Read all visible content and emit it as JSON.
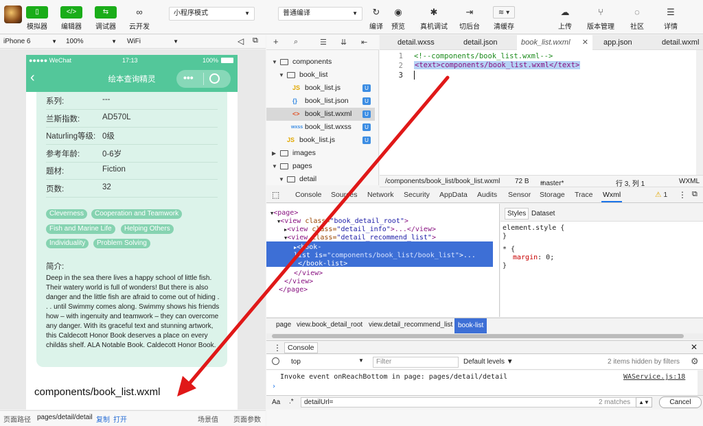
{
  "toolbar": {
    "simulator": "模拟器",
    "editor": "编辑器",
    "debugger": "调试器",
    "cloud": "云开发",
    "mode_select": "小程序模式",
    "compile_select": "普通编译",
    "compile": "编译",
    "preview": "预览",
    "real_debug": "真机调试",
    "background": "切后台",
    "clear_cache": "清缓存",
    "upload": "上传",
    "version": "版本管理",
    "community": "社区",
    "details": "详情",
    "accent_color": "#1aad19"
  },
  "simulator": {
    "device": "iPhone 6",
    "zoom": "100%",
    "network": "WiFi",
    "status_carrier": "●●●●● WeChat",
    "status_time": "17:13",
    "status_battery": "100%",
    "nav_title": "绘本查询精灵",
    "theme_color": "#53c79a",
    "info_rows": [
      {
        "key": "系列:",
        "value": "---"
      },
      {
        "key": "兰斯指数:",
        "value": "AD570L"
      },
      {
        "key": "Naturling等级:",
        "value": "0级"
      },
      {
        "key": "参考年龄:",
        "value": "0-6岁"
      },
      {
        "key": "题材:",
        "value": "Fiction"
      },
      {
        "key": "页数:",
        "value": "32"
      }
    ],
    "tags": [
      "Cleverness",
      "Cooperation and Teamwork",
      "Fish and Marine Life",
      "Helping Others",
      "Individuality",
      "Problem Solving"
    ],
    "summary_label": "简介:",
    "summary": "Deep in the sea there lives a happy school of little fish. Their watery world is full of wonders! But there is also danger and the little fish are afraid to come out of hiding . . . until Swimmy comes along. Swimmy shows his friends how – with ingenuity and teamwork – they can overcome any danger. With its graceful text and stunning artwork, this Caldecott Honor Book deserves a place on every childäs shelf. ALA Notable Book. Caldecott Honor Book.",
    "component_text": "components/book_list.wxml"
  },
  "footer": {
    "path_label": "页面路径",
    "path": "pages/detail/detail",
    "copy": "复制",
    "open": "打开",
    "scene": "场景值",
    "params": "页面参数"
  },
  "tree": {
    "items": [
      {
        "name": "components",
        "type": "folder"
      },
      {
        "name": "book_list",
        "type": "folder"
      },
      {
        "name": "book_list.js",
        "type": "js",
        "badge": "U"
      },
      {
        "name": "book_list.json",
        "type": "json",
        "badge": "U"
      },
      {
        "name": "book_list.wxml",
        "type": "wxml",
        "badge": "U"
      },
      {
        "name": "book_list.wxss",
        "type": "wxss",
        "badge": "U"
      },
      {
        "name": "book_list.js",
        "type": "js",
        "badge": "U"
      },
      {
        "name": "images",
        "type": "folder"
      },
      {
        "name": "pages",
        "type": "folder"
      },
      {
        "name": "detail",
        "type": "folder"
      }
    ]
  },
  "editor": {
    "tabs": [
      "detail.wxss",
      "detail.json",
      "book_list.wxml",
      "app.json",
      "detail.wxml"
    ],
    "lines": [
      "<!--components/book_list.wxml-->",
      "<text>components/book_list.wxml</text>",
      ""
    ],
    "line_numbers": [
      "1",
      "2",
      "3"
    ],
    "status_path": "/components/book_list/book_list.wxml",
    "status_size": "72 B",
    "status_branch": "master*",
    "status_pos": "行 3, 列 1",
    "status_lang": "WXML"
  },
  "devtools": {
    "tabs": [
      "Console",
      "Sources",
      "Network",
      "Security",
      "AppData",
      "Audits",
      "Sensor",
      "Storage",
      "Trace",
      "Wxml"
    ],
    "warning_count": "1",
    "wxml_lines": [
      {
        "tag_open": "<page>",
        "attr": "",
        "val": "",
        "tail": ""
      },
      {
        "tag_open": "<view",
        "attr": " class=",
        "val": "\"book_detail_root\"",
        "tail": ">"
      },
      {
        "tag_open": "<view",
        "attr": " class=",
        "val": "\"detail_info\"",
        "tail": ">...</view>"
      },
      {
        "tag_open": "<view",
        "attr": " class=",
        "val": "\"detail_recommend_list\"",
        "tail": ">"
      },
      {
        "tag_open": "<book-",
        "attr": "",
        "val": "",
        "tail": ""
      },
      {
        "tag_open": "list",
        "attr": " is=",
        "val": "\"components/book_list/book_list\"",
        "tail": ">..."
      },
      {
        "tag_open": "</book-list>",
        "attr": "",
        "val": "",
        "tail": ""
      },
      {
        "tag_open": "</view>",
        "attr": "",
        "val": "",
        "tail": ""
      },
      {
        "tag_open": "</view>",
        "attr": "",
        "val": "",
        "tail": ""
      },
      {
        "tag_open": "</page>",
        "attr": "",
        "val": "",
        "tail": ""
      }
    ],
    "styles_tab": "Styles",
    "dataset_tab": "Dataset",
    "element_style": "element.style {",
    "close_brace": "}",
    "star_rule": "* {",
    "margin_prop": "margin",
    "margin_val": "0;",
    "crumbs": [
      "page",
      "view.book_detail_root",
      "view.detail_recommend_list",
      "book-list"
    ]
  },
  "console": {
    "title": "Console",
    "context": "top",
    "filter_placeholder": "Filter",
    "levels": "Default levels ▼",
    "hidden": "2 items hidden by filters",
    "message": "Invoke event onReachBottom in page: pages/detail/detail",
    "source": "WAService.js:18",
    "prompt": "›",
    "search_value": "detailUrl=",
    "matches": "2 matches",
    "cancel": "Cancel",
    "aa": "Aa",
    "regex": ".*"
  }
}
